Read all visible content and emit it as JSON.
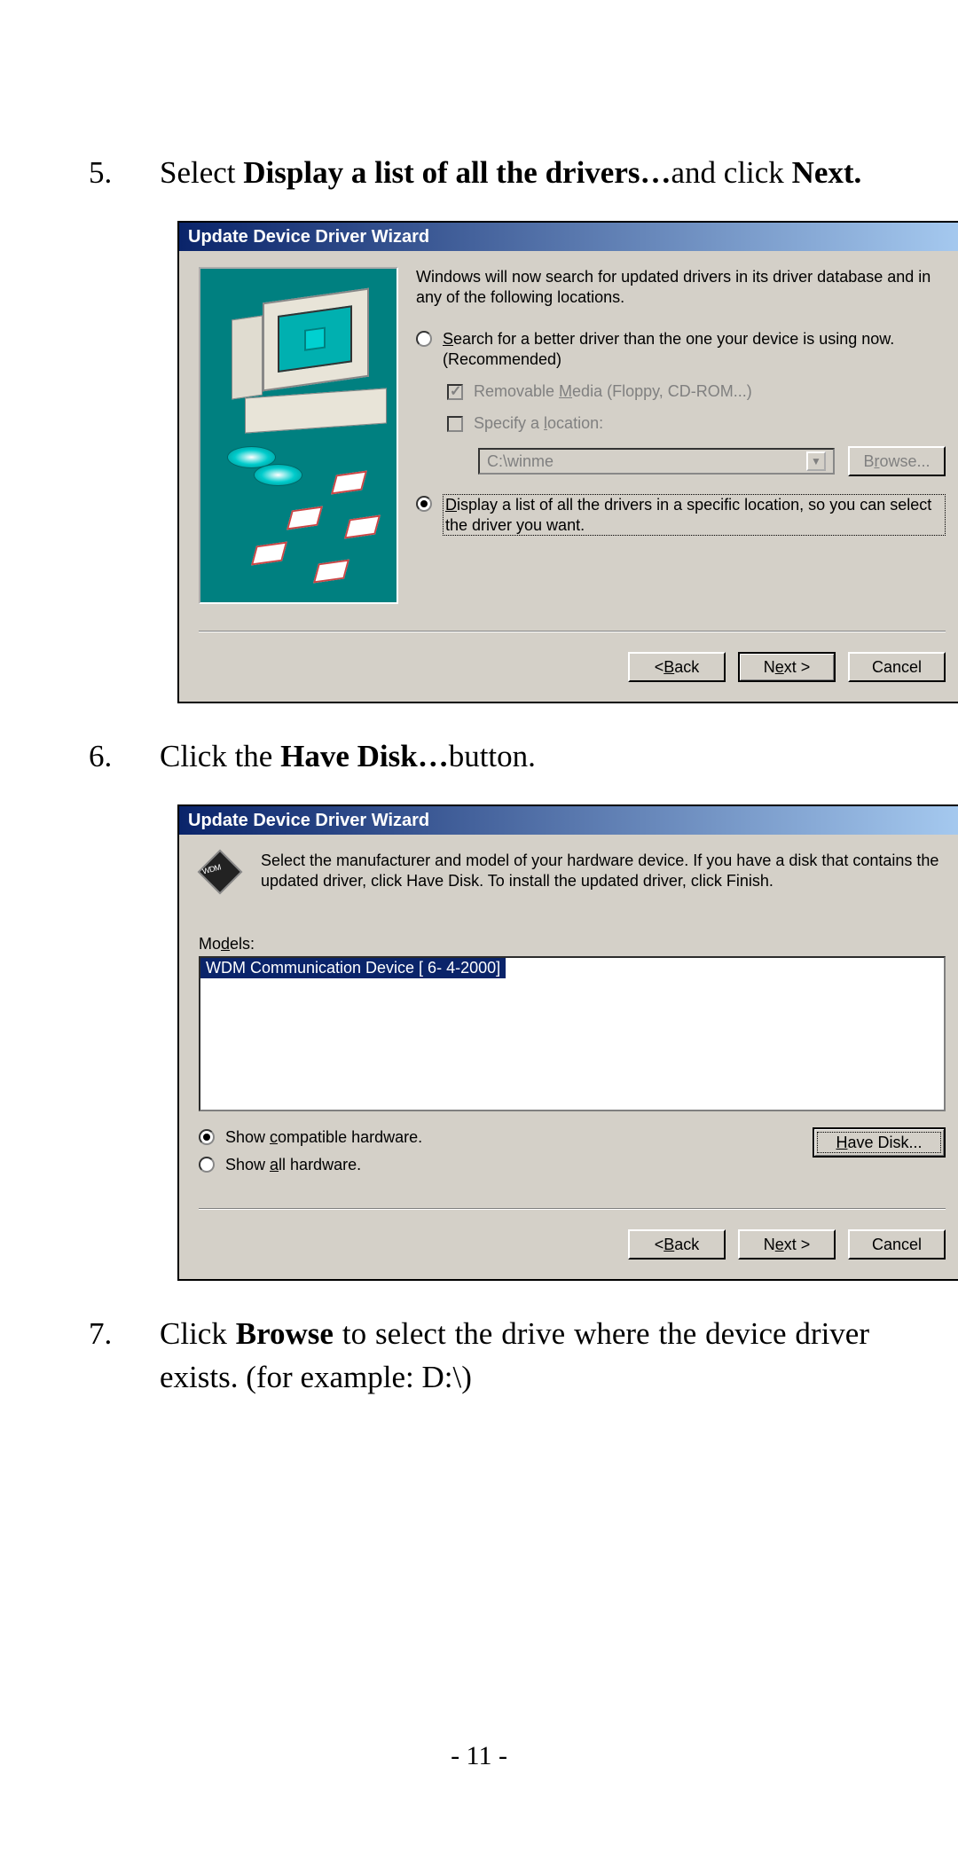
{
  "steps": {
    "s5": {
      "num": "5.",
      "pre": "Select ",
      "bold1": "Display a list of all the drivers…",
      "mid": "and click ",
      "bold2": "Next."
    },
    "s6": {
      "num": "6.",
      "pre": "Click the ",
      "bold1": "Have Disk…",
      "post": "button."
    },
    "s7": {
      "num": "7.",
      "pre": "Click ",
      "bold1": "Browse",
      "post": " to select the drive where the device driver exists.   (for example: D:\\)"
    }
  },
  "dialog1": {
    "title": "Update Device Driver Wizard",
    "intro": "Windows will now search for updated drivers in its driver database and in any of the following locations.",
    "opt_search_pre": "S",
    "opt_search_rest": "earch for a better driver than the one your device is using now. (Recommended)",
    "chk_media_pre": "Removable ",
    "chk_media_u": "M",
    "chk_media_rest": "edia (Floppy, CD-ROM...)",
    "chk_loc_pre": "Specify a ",
    "chk_loc_u": "l",
    "chk_loc_rest": "ocation:",
    "location_value": "C:\\winme",
    "browse_pre": "B",
    "browse_u": "r",
    "browse_rest": "owse...",
    "opt_display_u": "D",
    "opt_display_rest": "isplay a list of all the drivers in a specific location, so you can select the driver you want.",
    "back_pre": "< ",
    "back_u": "B",
    "back_rest": "ack",
    "next_pre": "N",
    "next_u": "e",
    "next_rest": "xt >",
    "cancel": "Cancel"
  },
  "dialog2": {
    "title": "Update Device Driver Wizard",
    "instr": "Select the manufacturer and model of your hardware device. If you have a disk that contains the updated driver, click Have Disk. To install the updated driver, click Finish.",
    "models_pre": "Mo",
    "models_u": "d",
    "models_rest": "els:",
    "model_item": "WDM Communication Device [ 6- 4-2000]",
    "show_compat_pre": "Show ",
    "show_compat_u": "c",
    "show_compat_rest": "ompatible hardware.",
    "show_all_pre": "Show ",
    "show_all_u": "a",
    "show_all_rest": "ll hardware.",
    "have_disk_u": "H",
    "have_disk_rest": "ave Disk...",
    "back_pre": "< ",
    "back_u": "B",
    "back_rest": "ack",
    "next_pre": "N",
    "next_u": "e",
    "next_rest": "xt >",
    "cancel": "Cancel"
  },
  "page_number": "- 11 -"
}
